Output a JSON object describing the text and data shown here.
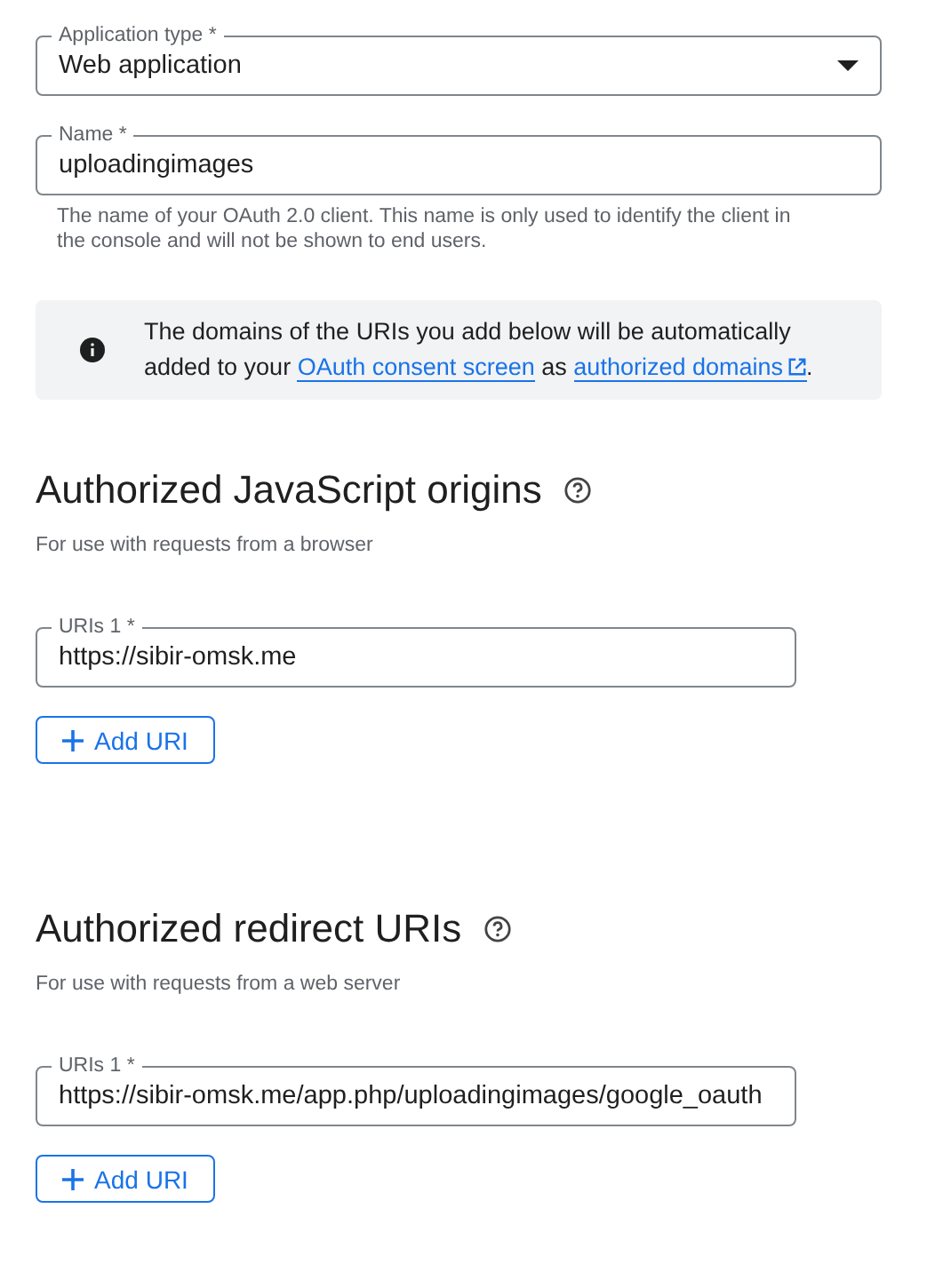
{
  "application_type": {
    "label": "Application type *",
    "value": "Web application"
  },
  "name_field": {
    "label": "Name *",
    "value": "uploadingimages",
    "hint": "The name of your OAuth 2.0 client. This name is only used to identify the client in the console and will not be shown to end users."
  },
  "info_notice": {
    "parts": [
      {
        "kind": "text",
        "text": "The domains of the URIs you add below will be automatically added to your "
      },
      {
        "kind": "link",
        "text": "OAuth consent screen"
      },
      {
        "kind": "text",
        "text": " as "
      },
      {
        "kind": "external_link",
        "text": "authorized domains"
      },
      {
        "kind": "text",
        "text": "."
      }
    ]
  },
  "sections": [
    {
      "title": "Authorized JavaScript origins",
      "subtitle": "For use with requests from a browser",
      "uris": [
        {
          "label": "URIs 1 *",
          "value": "https://sibir-omsk.me"
        }
      ],
      "add_button": "Add URI"
    },
    {
      "title": "Authorized redirect URIs",
      "subtitle": "For use with requests from a web server",
      "uris": [
        {
          "label": "URIs 1 *",
          "value": "https://sibir-omsk.me/app.php/uploadingimages/google_oauth"
        }
      ],
      "add_button": "Add URI"
    }
  ]
}
